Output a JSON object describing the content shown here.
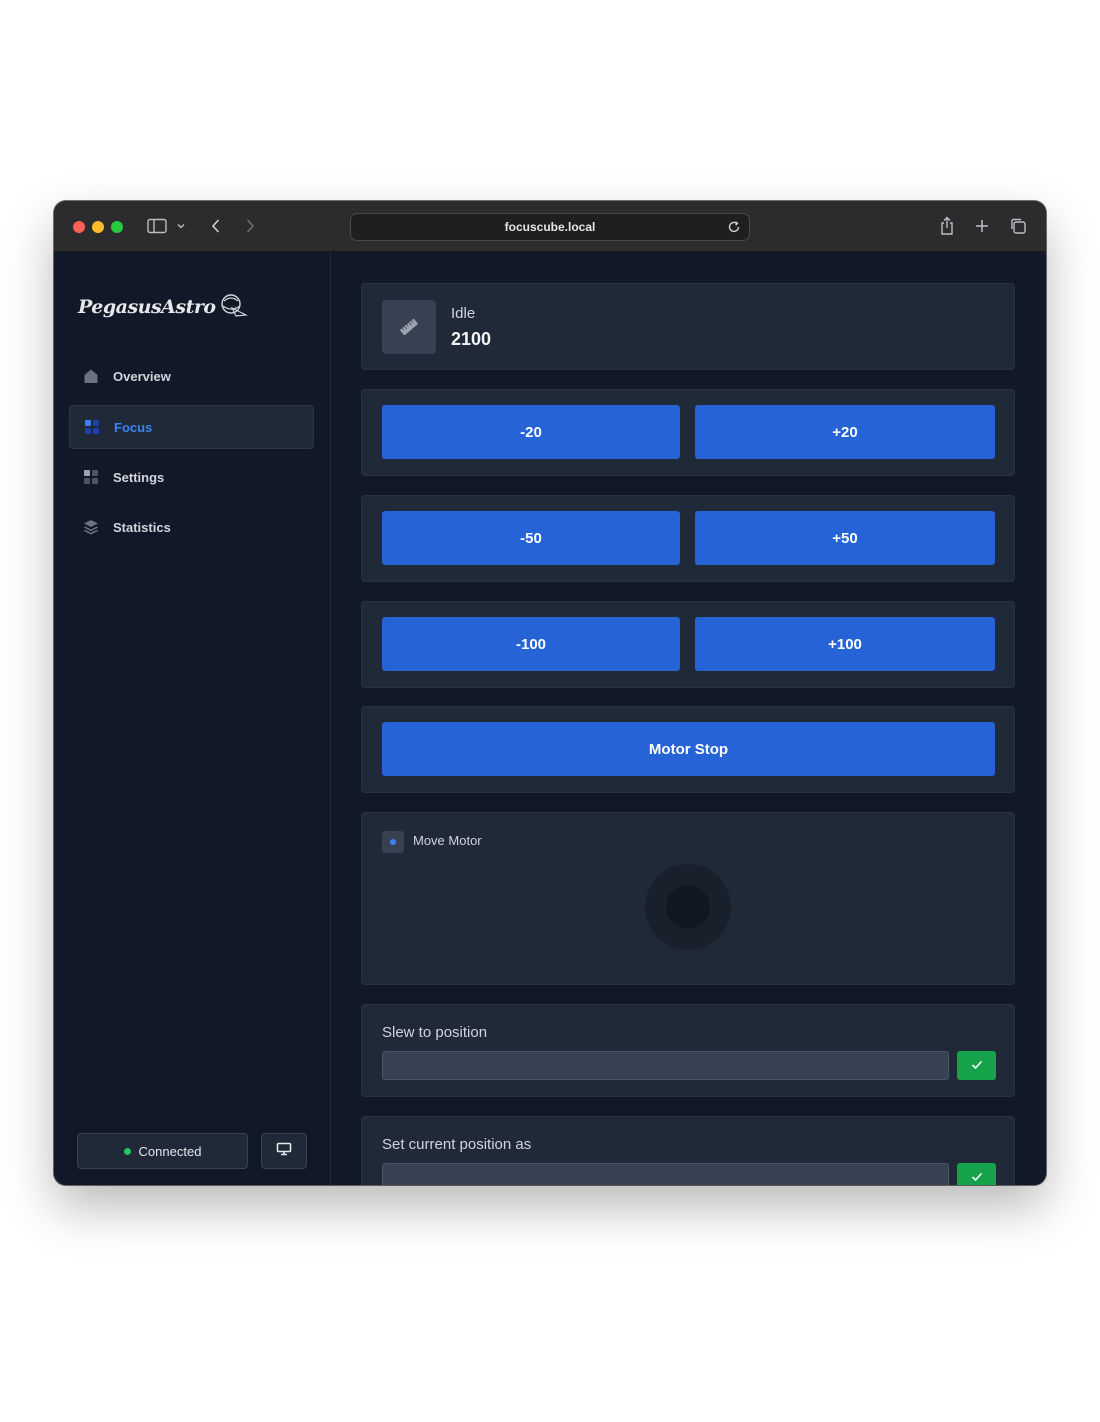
{
  "browser": {
    "url": "focuscube.local"
  },
  "sidebar": {
    "brand": "PegasusAstro",
    "items": [
      {
        "label": "Overview",
        "icon": "home-icon"
      },
      {
        "label": "Focus",
        "icon": "grid-icon",
        "active": true
      },
      {
        "label": "Settings",
        "icon": "grid-icon"
      },
      {
        "label": "Statistics",
        "icon": "layers-icon"
      }
    ],
    "connection_label": "Connected"
  },
  "status": {
    "label": "Idle",
    "position": "2100"
  },
  "steps": [
    {
      "minus": "-20",
      "plus": "+20"
    },
    {
      "minus": "-50",
      "plus": "+50"
    },
    {
      "minus": "-100",
      "plus": "+100"
    }
  ],
  "motor_stop_label": "Motor Stop",
  "move_motor_label": "Move Motor",
  "slew": {
    "label": "Slew to position",
    "value": ""
  },
  "set_position": {
    "label": "Set current position as",
    "value": ""
  },
  "colors": {
    "accent": "#2563d6",
    "active_nav": "#3b82f6",
    "success": "#16a34a",
    "background": "#111827",
    "card": "#1f2937"
  }
}
